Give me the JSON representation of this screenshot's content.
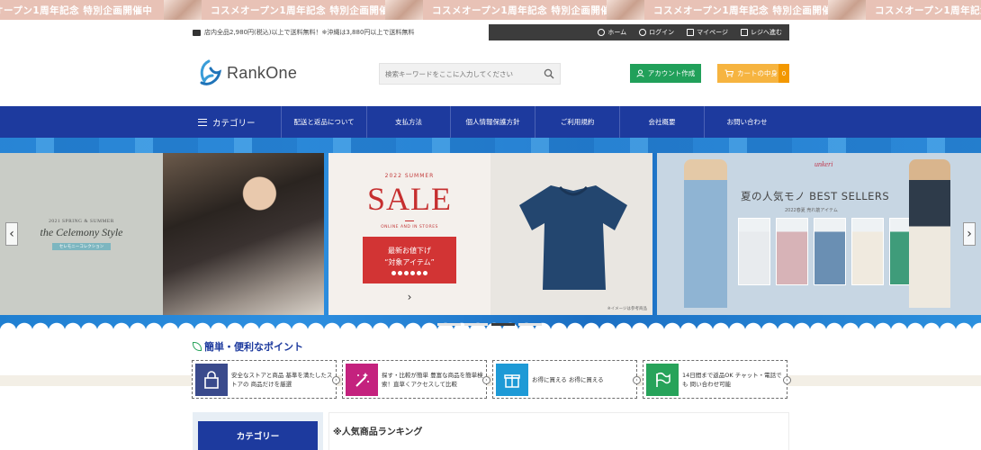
{
  "ticker": {
    "text": "コスメオープン1周年記念 特別企画開催中",
    "text_cut": "メオープン1周年記念 特別企画開催中"
  },
  "header": {
    "shipping": "店内全品2,980円(税込)以上で送料無料！※沖縄は3,880円以上で送料無料",
    "usernav": [
      {
        "label": "ホーム",
        "icon": "users-icon"
      },
      {
        "label": "ログイン",
        "icon": "user-icon"
      },
      {
        "label": "マイページ",
        "icon": "id-card-icon"
      },
      {
        "label": "レジへ進む",
        "icon": "register-icon"
      }
    ],
    "logo_text": "RankOne",
    "search_placeholder": "検索キーワードをここに入力してください",
    "account_button": "アカウント作成",
    "cart_button": "カートの中身",
    "cart_count": "0"
  },
  "nav": {
    "category": "カテゴリー",
    "items": [
      "配送と返品について",
      "支払方法",
      "個人情報保護方針",
      "ご利用規約",
      "会社概要",
      "お問い合わせ"
    ]
  },
  "hero": {
    "slide1": {
      "season": "2021 SPRING & SUMMER",
      "title": "the Celemony Style",
      "tag": "セレモニーコレクション"
    },
    "slide2": {
      "year": "2022 SUMMER",
      "sale": "SALE",
      "sub": "ONLINE AND IN STORES",
      "box_line1": "最新お値下げ",
      "box_line2": "“対象アイテム”",
      "note": "※イメージは参考商品"
    },
    "slide3": {
      "brand": "unkeri",
      "title": "夏の人気モノ BEST SELLERS",
      "sub": "2022春夏 売れ筋アイテム"
    },
    "prev": "‹",
    "next": "›",
    "active_dot": 3
  },
  "points": {
    "title": "簡単・便利なポイント",
    "items": [
      {
        "text": "安全なストアと商品 基準を満たしたストアの 商品だけを厳選",
        "color": "#3a4a8c",
        "icon": "lock-icon"
      },
      {
        "text": "探す・比較が簡単 豊富な商品を簡単検索！直草くアクセスして比較",
        "color": "#c4227e",
        "icon": "magic-wand-icon"
      },
      {
        "text": "お得に買える お得に買える",
        "color": "#1e9ad6",
        "icon": "gift-icon"
      },
      {
        "text": "14日間まで返品OK チャット・電話でも 問い合わせ可能",
        "color": "#27a35a",
        "icon": "flag-icon"
      }
    ]
  },
  "sidebar": {
    "category_button": "カテゴリー"
  },
  "ranking": {
    "title": "※人気商品ランキング"
  }
}
